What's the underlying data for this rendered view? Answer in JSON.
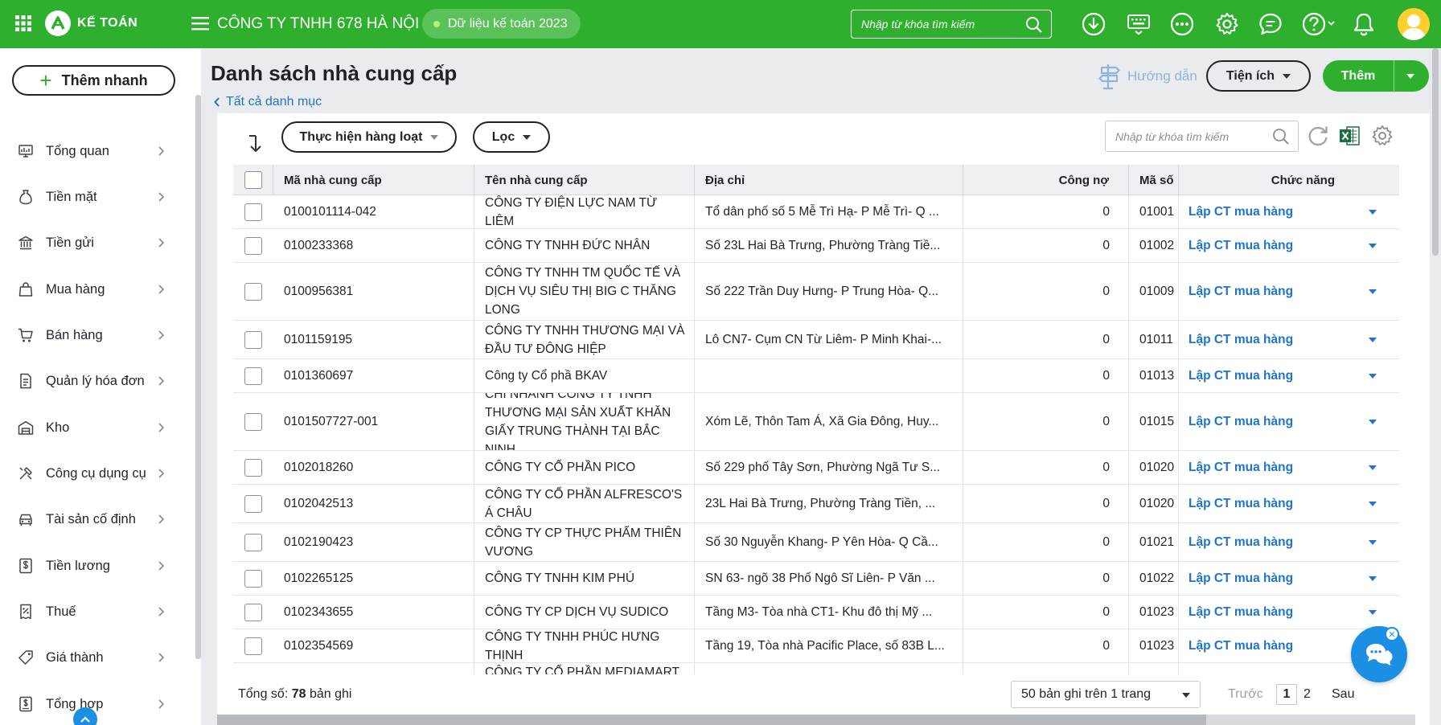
{
  "app": {
    "logo_text": "KẾ TOÁN",
    "company": "CÔNG TY TNHH 678 HÀ NỘI",
    "dataset": "Dữ liệu kế toán 2023",
    "search_placeholder": "Nhập từ khóa tìm kiếm"
  },
  "colors": {
    "brand_green": "#2eb02e",
    "link_blue": "#1f73c9",
    "chat_blue": "#1a8fe3"
  },
  "top_icons": [
    "download-icon",
    "keyboard-icon",
    "more-icon",
    "settings-icon",
    "chat-icon",
    "help-icon",
    "bell-icon",
    "avatar"
  ],
  "sidebar": {
    "quick_add": "Thêm nhanh",
    "items": [
      {
        "label": "Tổng quan",
        "icon": "dashboard-icon"
      },
      {
        "label": "Tiền mặt",
        "icon": "money-bag-icon"
      },
      {
        "label": "Tiền gửi",
        "icon": "bank-icon"
      },
      {
        "label": "Mua hàng",
        "icon": "shopping-bag-icon"
      },
      {
        "label": "Bán hàng",
        "icon": "cart-icon"
      },
      {
        "label": "Quản lý hóa đơn",
        "icon": "invoice-icon"
      },
      {
        "label": "Kho",
        "icon": "warehouse-icon"
      },
      {
        "label": "Công cụ dụng cụ",
        "icon": "tools-icon"
      },
      {
        "label": "Tài sản cố định",
        "icon": "car-icon"
      },
      {
        "label": "Tiền lương",
        "icon": "salary-icon"
      },
      {
        "label": "Thuế",
        "icon": "tax-icon"
      },
      {
        "label": "Giá thành",
        "icon": "price-tag-icon"
      },
      {
        "label": "Tổng hợp",
        "icon": "summary-icon"
      }
    ]
  },
  "page": {
    "title": "Danh sách nhà cung cấp",
    "back": "Tất cả danh mục",
    "help": "Hướng dẫn",
    "utilities": "Tiện ích",
    "add": "Thêm"
  },
  "toolbar": {
    "bulk": "Thực hiện hàng loạt",
    "filter": "Lọc",
    "search_placeholder": "Nhập từ khóa tìm kiếm"
  },
  "table": {
    "headers": [
      "Mã nhà cung cấp",
      "Tên nhà cung cấp",
      "Địa chỉ",
      "Công nợ",
      "Mã số",
      "Chức năng"
    ],
    "action_label": "Lập CT mua hàng",
    "rows": [
      {
        "code": "0100101114-042",
        "name": "CÔNG TY ĐIỆN LỰC NAM TỪ LIÊM",
        "address": "Tổ dân phố số 5 Mễ Trì Hạ- P Mễ Trì- Q ...",
        "debt": "0",
        "tax": "01001"
      },
      {
        "code": "0100233368",
        "name": "CÔNG TY TNHH ĐỨC NHÂN",
        "address": "Số 23L Hai Bà Trưng, Phường Tràng Tiề...",
        "debt": "0",
        "tax": "01002"
      },
      {
        "code": "0100956381",
        "name": "CÔNG TY TNHH TM QUỐC TẾ VÀ DỊCH VỤ SIÊU THỊ BIG C THĂNG LONG",
        "address": "Số 222 Trần Duy Hưng- P Trung Hòa- Q...",
        "debt": "0",
        "tax": "01009"
      },
      {
        "code": "0101159195",
        "name": "CÔNG TY TNHH THƯƠNG MẠI VÀ ĐẦU TƯ ĐÔNG HIỆP",
        "address": "Lô CN7- Cụm CN Từ Liêm- P Minh Khai-...",
        "debt": "0",
        "tax": "01011"
      },
      {
        "code": "0101360697",
        "name": "Công ty Cổ phầ BKAV",
        "address": "",
        "debt": "0",
        "tax": "01013"
      },
      {
        "code": "0101507727-001",
        "name": "CHI NHÁNH CÔNG TY TNHH THƯƠNG MẠI SẢN XUẤT KHĂN GIẤY TRUNG THÀNH TẠI BẮC NINH",
        "address": "Xóm Lẽ, Thôn Tam Á, Xã Gia Đông, Huy...",
        "debt": "0",
        "tax": "01015"
      },
      {
        "code": "0102018260",
        "name": "CÔNG TY CỔ PHẦN PICO",
        "address": "Số 229 phố Tây Sơn, Phường Ngã Tư S...",
        "debt": "0",
        "tax": "01020"
      },
      {
        "code": "0102042513",
        "name": "CÔNG TY CỔ PHẦN ALFRESCO'S Á CHÂU",
        "address": "23L Hai Bà Trưng, Phường Tràng Tiền, ...",
        "debt": "0",
        "tax": "01020"
      },
      {
        "code": "0102190423",
        "name": "CÔNG TY CP THỰC PHẨM THIÊN VƯƠNG",
        "address": "Số 30 Nguyễn Khang- P Yên Hòa- Q Cầ...",
        "debt": "0",
        "tax": "01021"
      },
      {
        "code": "0102265125",
        "name": "CÔNG TY TNHH KIM PHÚ",
        "address": "SN 63- ngõ 38 Phố Ngô Sĩ Liên- P Văn ...",
        "debt": "0",
        "tax": "01022"
      },
      {
        "code": "0102343655",
        "name": "CÔNG TY CP DỊCH VỤ SUDICO",
        "address": "Tầng M3- Tòa nhà CT1- Khu đô thị Mỹ ...",
        "debt": "0",
        "tax": "01023"
      },
      {
        "code": "0102354569",
        "name": "CÔNG TY TNHH PHÚC HƯNG THỊNH",
        "address": "Tầng 19, Tòa nhà Pacific Place, số 83B L...",
        "debt": "0",
        "tax": "01023"
      },
      {
        "code": "",
        "name": "CÔNG TY CỔ PHẦN MEDIAMART VIỆT",
        "address": "",
        "debt": "",
        "tax": ""
      }
    ]
  },
  "footer": {
    "total_label": "Tổng số:",
    "total_value": "78",
    "total_unit": "bản ghi",
    "page_size": "50 bản ghi trên 1 trang",
    "prev": "Trước",
    "page1": "1",
    "page2": "2",
    "next": "Sau"
  }
}
